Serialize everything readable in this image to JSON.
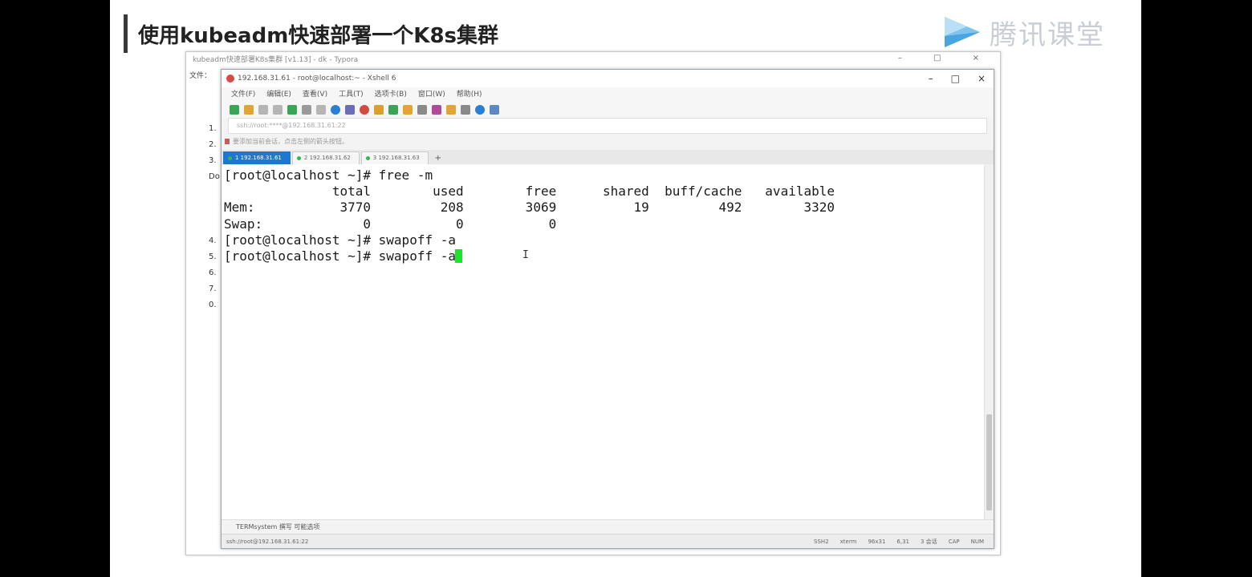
{
  "slide": {
    "title": "使用kubeadm快速部署一个K8s集群",
    "brand": "腾讯课堂"
  },
  "doc_window": {
    "title": "kubeadm快速部署K8s集群 [v1.13] - dk - Typora",
    "menu_label": "文件：",
    "list_markers": [
      "1.",
      "2.",
      "3.",
      "Do",
      "4.",
      "5.",
      "6.",
      "7.",
      "0."
    ]
  },
  "xshell": {
    "title": "192.168.31.61 - root@localhost:~ - Xshell 6",
    "menu": [
      "文件(F)",
      "编辑(E)",
      "查看(V)",
      "工具(T)",
      "选项卡(B)",
      "窗口(W)",
      "帮助(H)"
    ],
    "address": "ssh://root:****@192.168.31.61:22",
    "hint": "要添加当前会话，点击左侧的箭头按钮。",
    "tabs": [
      {
        "label": "1 192.168.31.61",
        "active": true
      },
      {
        "label": "2 192.168.31.62",
        "active": false
      },
      {
        "label": "3 192.168.31.63",
        "active": false
      }
    ],
    "tab_add": "+",
    "terminal_lines": [
      "[root@localhost ~]# free -m",
      "              total        used        free      shared  buff/cache   available",
      "Mem:           3770         208        3069          19         492        3320",
      "Swap:             0           0           0",
      "[root@localhost ~]# swapoff -a",
      "[root@localhost ~]# swapoff -a"
    ],
    "bottom_bar": "TERMsystem   撰写   可能选项",
    "status_left": "ssh://root@192.168.31.61:22",
    "status_right": [
      "SSH2",
      "xterm",
      "96x31",
      "6,31",
      "3 会话",
      "CAP",
      "NUM"
    ]
  },
  "colors": {
    "cursor": "#19e52f",
    "active_tab": "#1e78d2",
    "brand_gray": "#c9ced6"
  }
}
